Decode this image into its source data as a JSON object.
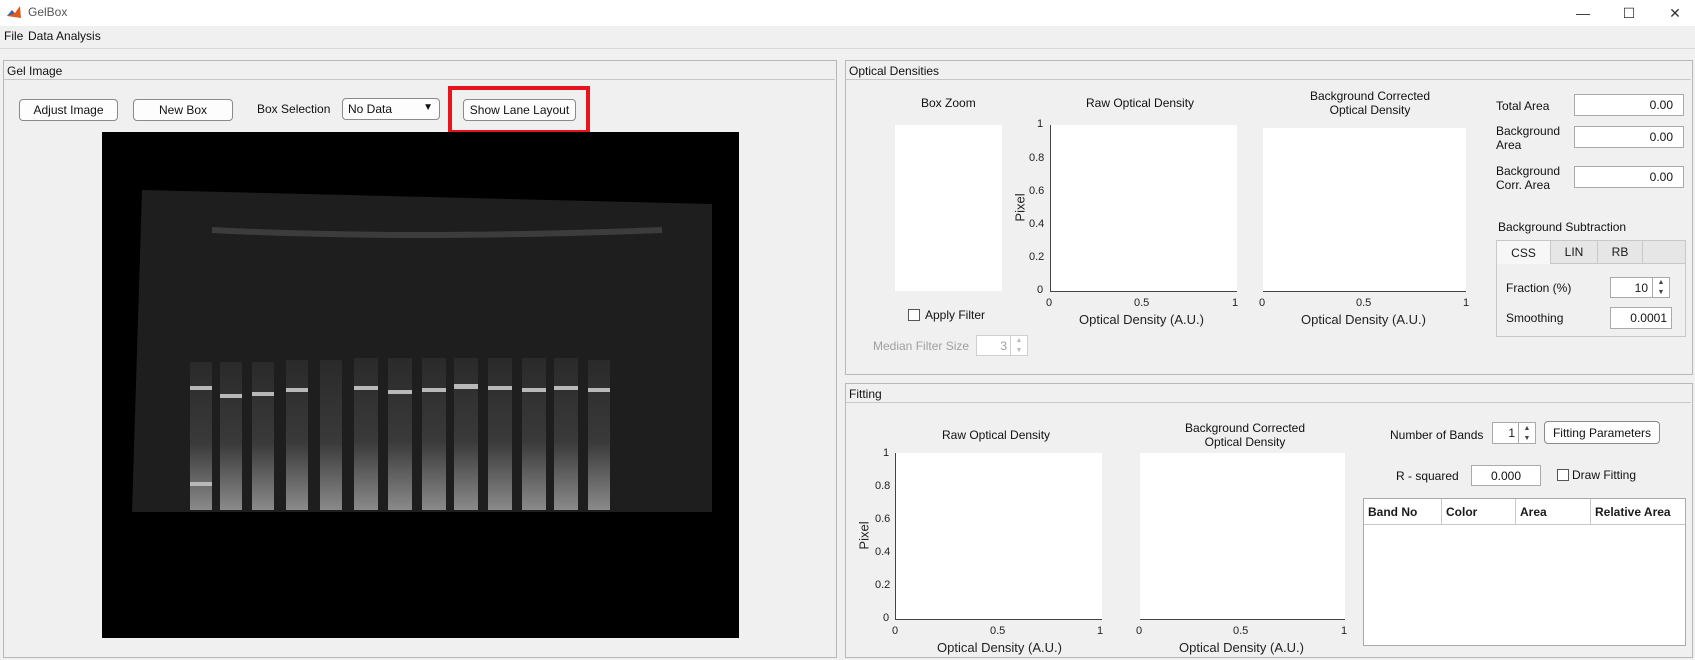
{
  "window": {
    "title": "GelBox",
    "minimize_glyph": "—",
    "maximize_glyph": "☐",
    "close_glyph": "✕",
    "app_icon": "matlab-icon"
  },
  "menu": [
    "File",
    "Data Analysis"
  ],
  "gel_panel": {
    "title": "Gel Image",
    "adjust_image_label": "Adjust Image",
    "new_box_label": "New Box",
    "box_selection_label": "Box Selection",
    "box_selection_value": "No Data",
    "show_lane_layout_label": "Show Lane Layout",
    "highlight_color": "#e8141c"
  },
  "optical_panel": {
    "title": "Optical Densities",
    "box_zoom_title": "Box Zoom",
    "raw_title": "Raw Optical Density",
    "bg_corr_title_1": "Background Corrected",
    "bg_corr_title_2": "Optical Density",
    "apply_filter_label": "Apply Filter",
    "median_filter_label": "Median Filter Size",
    "median_filter_value": "3",
    "total_area_label": "Total Area",
    "total_area_value": "0.00",
    "bg_area_label_1": "Background",
    "bg_area_label_2": "Area",
    "bg_area_value": "0.00",
    "bg_corr_area_label_1": "Background",
    "bg_corr_area_label_2": "Corr. Area",
    "bg_corr_area_value": "0.00",
    "bg_subtraction_label": "Background Subtraction",
    "tabs": [
      "CSS",
      "LIN",
      "RB"
    ],
    "fraction_label": "Fraction (%)",
    "fraction_value": "10",
    "smoothing_label": "Smoothing",
    "smoothing_value": "0.0001",
    "raw_axes": {
      "ylabel": "Pixel",
      "xlabel": "Optical Density (A.U.)",
      "yticks": [
        "1",
        "0.8",
        "0.6",
        "0.4",
        "0.2",
        "0"
      ],
      "xticks": [
        "0",
        "0.5",
        "1"
      ]
    },
    "bg_axes": {
      "xlabel": "Optical Density (A.U.)",
      "xticks": [
        "0",
        "0.5",
        "1"
      ]
    }
  },
  "fitting_panel": {
    "title": "Fitting",
    "raw_title": "Raw Optical Density",
    "bg_corr_title_1": "Background Corrected",
    "bg_corr_title_2": "Optical Density",
    "number_of_bands_label": "Number of Bands",
    "number_of_bands_value": "1",
    "fitting_parameters_label": "Fitting Parameters",
    "r_squared_label": "R - squared",
    "r_squared_value": "0.000",
    "draw_fitting_label": "Draw Fitting",
    "table_headers": [
      "Band No",
      "Color",
      "Area",
      "Relative Area"
    ],
    "raw_axes": {
      "ylabel": "Pixel",
      "xlabel": "Optical Density (A.U.)",
      "yticks": [
        "1",
        "0.8",
        "0.6",
        "0.4",
        "0.2",
        "0"
      ],
      "xticks": [
        "0",
        "0.5",
        "1"
      ]
    },
    "bg_axes": {
      "xlabel": "Optical Density (A.U.)",
      "xticks": [
        "0",
        "0.5",
        "1"
      ]
    }
  }
}
